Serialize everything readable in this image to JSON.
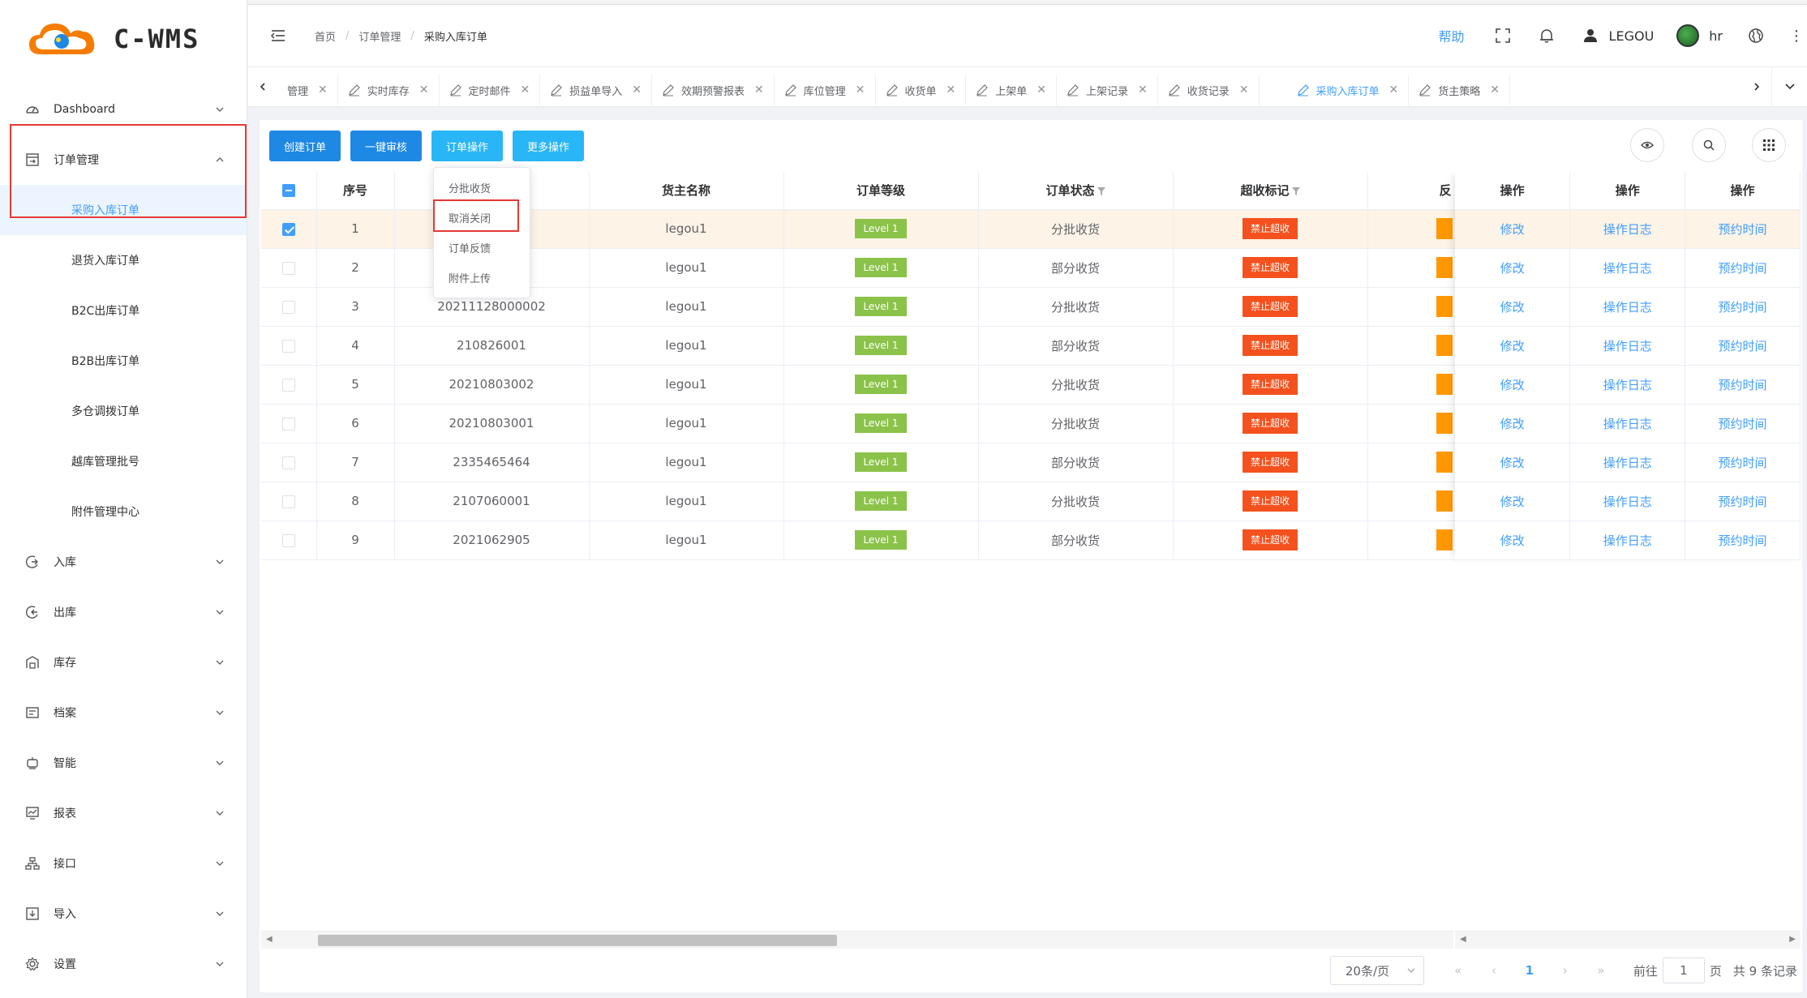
{
  "app": {
    "logo_text": "C-WMS"
  },
  "header": {
    "breadcrumb": [
      "首页",
      "订单管理",
      "采购入库订单"
    ],
    "help": "帮助",
    "user": "LEGOU",
    "avatar_name": "hr"
  },
  "sidebar": {
    "dashboard": "Dashboard",
    "order_mgmt": "订单管理",
    "sub_items": [
      "采购入库订单",
      "退货入库订单",
      "B2C出库订单",
      "B2B出库订单",
      "多仓调拨订单",
      "越库管理批号",
      "附件管理中心"
    ],
    "groups": [
      "入库",
      "出库",
      "库存",
      "档案",
      "智能",
      "报表",
      "接口",
      "导入",
      "设置"
    ]
  },
  "tabs": [
    {
      "label": "管理",
      "active": false
    },
    {
      "label": "实时库存",
      "active": false
    },
    {
      "label": "定时邮件",
      "active": false
    },
    {
      "label": "损益单导入",
      "active": false
    },
    {
      "label": "效期预警报表",
      "active": false
    },
    {
      "label": "库位管理",
      "active": false
    },
    {
      "label": "收货单",
      "active": false
    },
    {
      "label": "上架单",
      "active": false
    },
    {
      "label": "上架记录",
      "active": false
    },
    {
      "label": "收货记录",
      "active": false
    },
    {
      "label": "采购入库订单",
      "active": true
    },
    {
      "label": "货主策略",
      "active": false
    }
  ],
  "toolbar": {
    "create": "创建订单",
    "audit": "一键审核",
    "order_ops": "订单操作",
    "more_ops": "更多操作"
  },
  "dropdown": [
    "分批收货",
    "取消关闭",
    "订单反馈",
    "附件上传"
  ],
  "table": {
    "headers": {
      "seq": "序号",
      "order_no": "",
      "owner": "货主名称",
      "level": "订单等级",
      "status": "订单状态",
      "over": "超收标记",
      "fb": "反",
      "op1": "操作",
      "op2": "操作",
      "op3": "操作"
    },
    "rows": [
      {
        "seq": "1",
        "order_no": "",
        "owner": "legou1",
        "level": "Level 1",
        "status": "分批收货",
        "over": "禁止超收",
        "checked": true
      },
      {
        "seq": "2",
        "order_no": "",
        "owner": "legou1",
        "level": "Level 1",
        "status": "部分收货",
        "over": "禁止超收",
        "checked": false
      },
      {
        "seq": "3",
        "order_no": "20211128000002",
        "owner": "legou1",
        "level": "Level 1",
        "status": "分批收货",
        "over": "禁止超收",
        "checked": false
      },
      {
        "seq": "4",
        "order_no": "210826001",
        "owner": "legou1",
        "level": "Level 1",
        "status": "部分收货",
        "over": "禁止超收",
        "checked": false
      },
      {
        "seq": "5",
        "order_no": "20210803002",
        "owner": "legou1",
        "level": "Level 1",
        "status": "分批收货",
        "over": "禁止超收",
        "checked": false
      },
      {
        "seq": "6",
        "order_no": "20210803001",
        "owner": "legou1",
        "level": "Level 1",
        "status": "分批收货",
        "over": "禁止超收",
        "checked": false
      },
      {
        "seq": "7",
        "order_no": "2335465464",
        "owner": "legou1",
        "level": "Level 1",
        "status": "部分收货",
        "over": "禁止超收",
        "checked": false
      },
      {
        "seq": "8",
        "order_no": "2107060001",
        "owner": "legou1",
        "level": "Level 1",
        "status": "分批收货",
        "over": "禁止超收",
        "checked": false
      },
      {
        "seq": "9",
        "order_no": "2021062905",
        "owner": "legou1",
        "level": "Level 1",
        "status": "部分收货",
        "over": "禁止超收",
        "checked": false
      }
    ],
    "actions": {
      "edit": "修改",
      "log": "操作日志",
      "reserve": "预约时间"
    }
  },
  "pager": {
    "page_size": "20条/页",
    "current": "1",
    "goto_prefix": "前往",
    "goto_value": "1",
    "goto_suffix": "页",
    "total": "共 9 条记录"
  },
  "colors": {
    "primary": "#409eff",
    "btn_blue": "#1e88e5",
    "btn_sky": "#29b6f6",
    "level_tag": "#8bc34a",
    "forbid_tag": "#f4511e",
    "highlight": "#e53935"
  }
}
